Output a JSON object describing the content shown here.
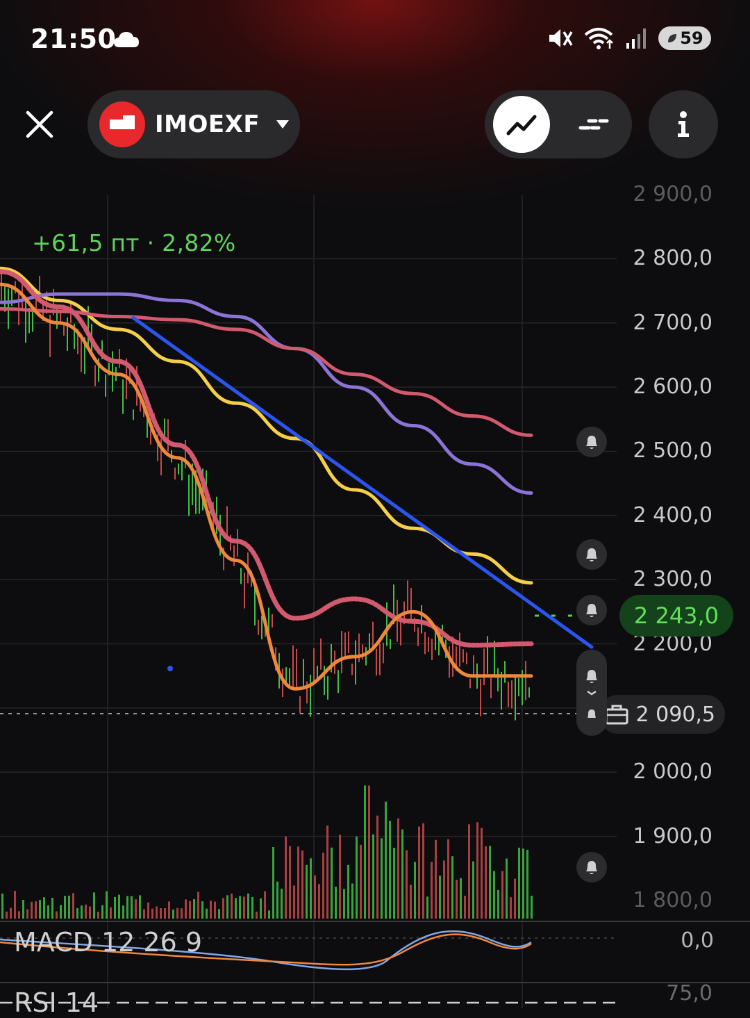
{
  "status_bar": {
    "time": "21:50",
    "weather_icon": "cloud-icon",
    "icons": [
      "mute-icon",
      "wifi-icon",
      "signal-icon"
    ],
    "battery": "59"
  },
  "toolbar": {
    "ticker": "IMOEXF",
    "active_mode": "line-chart-icon",
    "other_mode": "candles-icon",
    "info": "i"
  },
  "chart": {
    "change_text": "+61,5 пт · 2,82%",
    "current_price": "2 243,0",
    "position_price": "2 090,5",
    "colors": {
      "up": "#3fbf46",
      "down": "#c44a4a",
      "yellow_ma": "#f4cf4a",
      "purple_ma": "#8b74d6",
      "red_ma": "#d2596e",
      "orange_ma": "#f0883c",
      "trendline": "#2a55f0"
    }
  },
  "chart_data": {
    "type": "line",
    "title": "",
    "y_ticks": [
      "2 900,0",
      "2 800,0",
      "2 700,0",
      "2 600,0",
      "2 500,0",
      "2 400,0",
      "2 300,0",
      "2 200,0",
      "2 000,0",
      "1 900,0",
      "1 800,0"
    ],
    "ylim": [
      1800,
      2900
    ],
    "grid": true,
    "series": [
      {
        "values": [
          2785,
          2735,
          2690,
          2640,
          2575,
          2520,
          2440,
          2380,
          2340,
          2295
        ]
      },
      {
        "values": [
          2732,
          2745,
          2745,
          2735,
          2710,
          2660,
          2600,
          2540,
          2480,
          2435
        ]
      },
      {
        "values": [
          2722,
          2718,
          2710,
          2705,
          2690,
          2660,
          2620,
          2590,
          2555,
          2525
        ]
      },
      {
        "values": [
          2780,
          2725,
          2640,
          2510,
          2360,
          2240,
          2270,
          2235,
          2198,
          2200
        ]
      },
      {
        "values": [
          2760,
          2700,
          2620,
          2490,
          2330,
          2130,
          2180,
          2250,
          2150,
          2150
        ]
      }
    ],
    "trendline": {
      "from": 2708,
      "to": 2195
    },
    "macd": {
      "label": "MACD 12 26 9",
      "zero": "0,0"
    },
    "rsi": {
      "label": "RSI 14",
      "value": "75,0"
    }
  }
}
